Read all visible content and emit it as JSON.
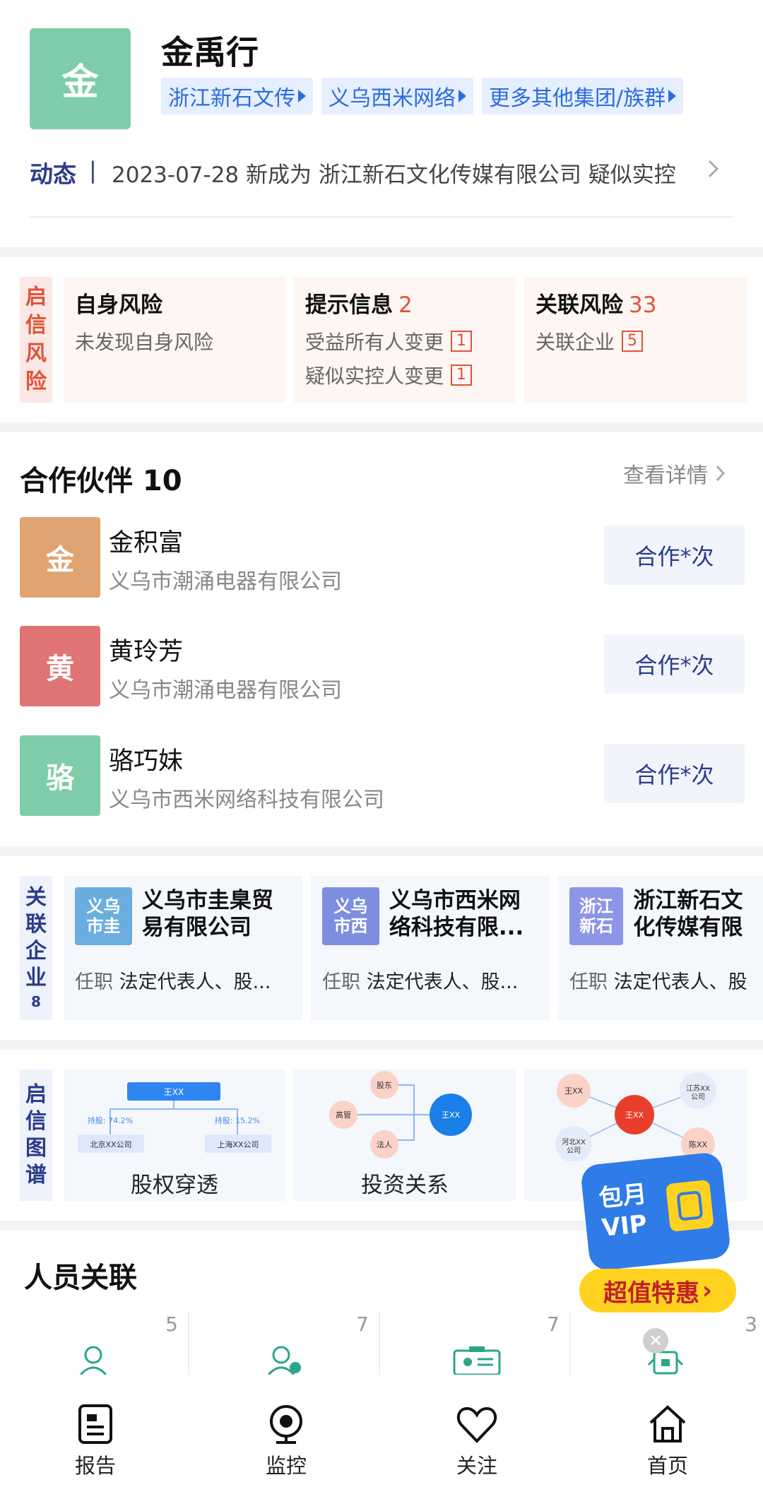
{
  "header": {
    "avatar_char": "金",
    "name": "金禹行",
    "tags": [
      "浙江新石文传",
      "义乌西米网络",
      "更多其他集团/族群"
    ],
    "dynamic_label": "动态",
    "dynamic_sep": "|",
    "dynamic_text": "2023-07-28 新成为 浙江新石文化传媒有限公司 疑似实控"
  },
  "risk": {
    "side_label": [
      "启",
      "信",
      "风",
      "险"
    ],
    "self": {
      "title": "自身风险",
      "desc": "未发现自身风险"
    },
    "hint": {
      "title": "提示信息",
      "count": "2",
      "items": [
        {
          "label": "受益所有人变更",
          "n": "1"
        },
        {
          "label": "疑似实控人变更",
          "n": "1"
        }
      ]
    },
    "related": {
      "title": "关联风险",
      "count": "33",
      "items": [
        {
          "label": "关联企业",
          "n": "5"
        }
      ]
    }
  },
  "partners": {
    "title": "合作伙伴 10",
    "more": "查看详情",
    "items": [
      {
        "char": "金",
        "name": "金积富",
        "company": "义乌市潮涌电器有限公司",
        "button": "合作*次",
        "color": "#e0a473"
      },
      {
        "char": "黄",
        "name": "黄玲芳",
        "company": "义乌市潮涌电器有限公司",
        "button": "合作*次",
        "color": "#e07474"
      },
      {
        "char": "骆",
        "name": "骆巧妹",
        "company": "义乌市西米网络科技有限公司",
        "button": "合作*次",
        "color": "#7fcda8"
      }
    ]
  },
  "related_companies": {
    "side_label": [
      "关",
      "联",
      "企",
      "业"
    ],
    "count": "8",
    "items": [
      {
        "logo": "义乌\n市圭",
        "name": "义乌市圭臬贸易有限公司",
        "role_prefix": "任职",
        "role": "法定代表人、股...",
        "color": "#6aaee0"
      },
      {
        "logo": "义乌\n市西",
        "name": "义乌市西米网络科技有限...",
        "role_prefix": "任职",
        "role": "法定代表人、股...",
        "color": "#7d8ee0"
      },
      {
        "logo": "浙江\n新石",
        "name": "浙江新石文化传媒有限公",
        "role_prefix": "任职",
        "role": "法定代表人、股",
        "color": "#8c95e6"
      }
    ]
  },
  "graphs": {
    "side_label": [
      "启",
      "信",
      "图",
      "谱"
    ],
    "items": [
      {
        "label": "股权穿透",
        "top": "王XX",
        "pct1": "持股: 74.2%",
        "pct2": "持股: 15.2%",
        "c1": "北京XX公司",
        "c2": "上海XX公司"
      },
      {
        "label": "投资关系",
        "n1": "股东",
        "n2": "高管",
        "n3": "法人",
        "center": "王XX"
      },
      {
        "label": "",
        "a": "王XX",
        "b": "江苏XX\n公司",
        "c": "河北XX\n公司",
        "d": "陈XX",
        "center": "王XX"
      }
    ]
  },
  "people": {
    "title": "人员关联",
    "counts": [
      "5",
      "7",
      "7",
      "3"
    ]
  },
  "vip": {
    "line1": "包月",
    "line2": "VIP",
    "banner": "超值特惠"
  },
  "nav": [
    {
      "label": "报告",
      "icon": "report-icon"
    },
    {
      "label": "监控",
      "icon": "monitor-icon"
    },
    {
      "label": "关注",
      "icon": "heart-icon"
    },
    {
      "label": "首页",
      "icon": "home-icon"
    }
  ],
  "colors": {
    "accent": "#2b3c8a",
    "risk": "#e0523a",
    "green": "#7fcda8",
    "vip_blue": "#2f7be8",
    "vip_yellow": "#ffd21f"
  }
}
